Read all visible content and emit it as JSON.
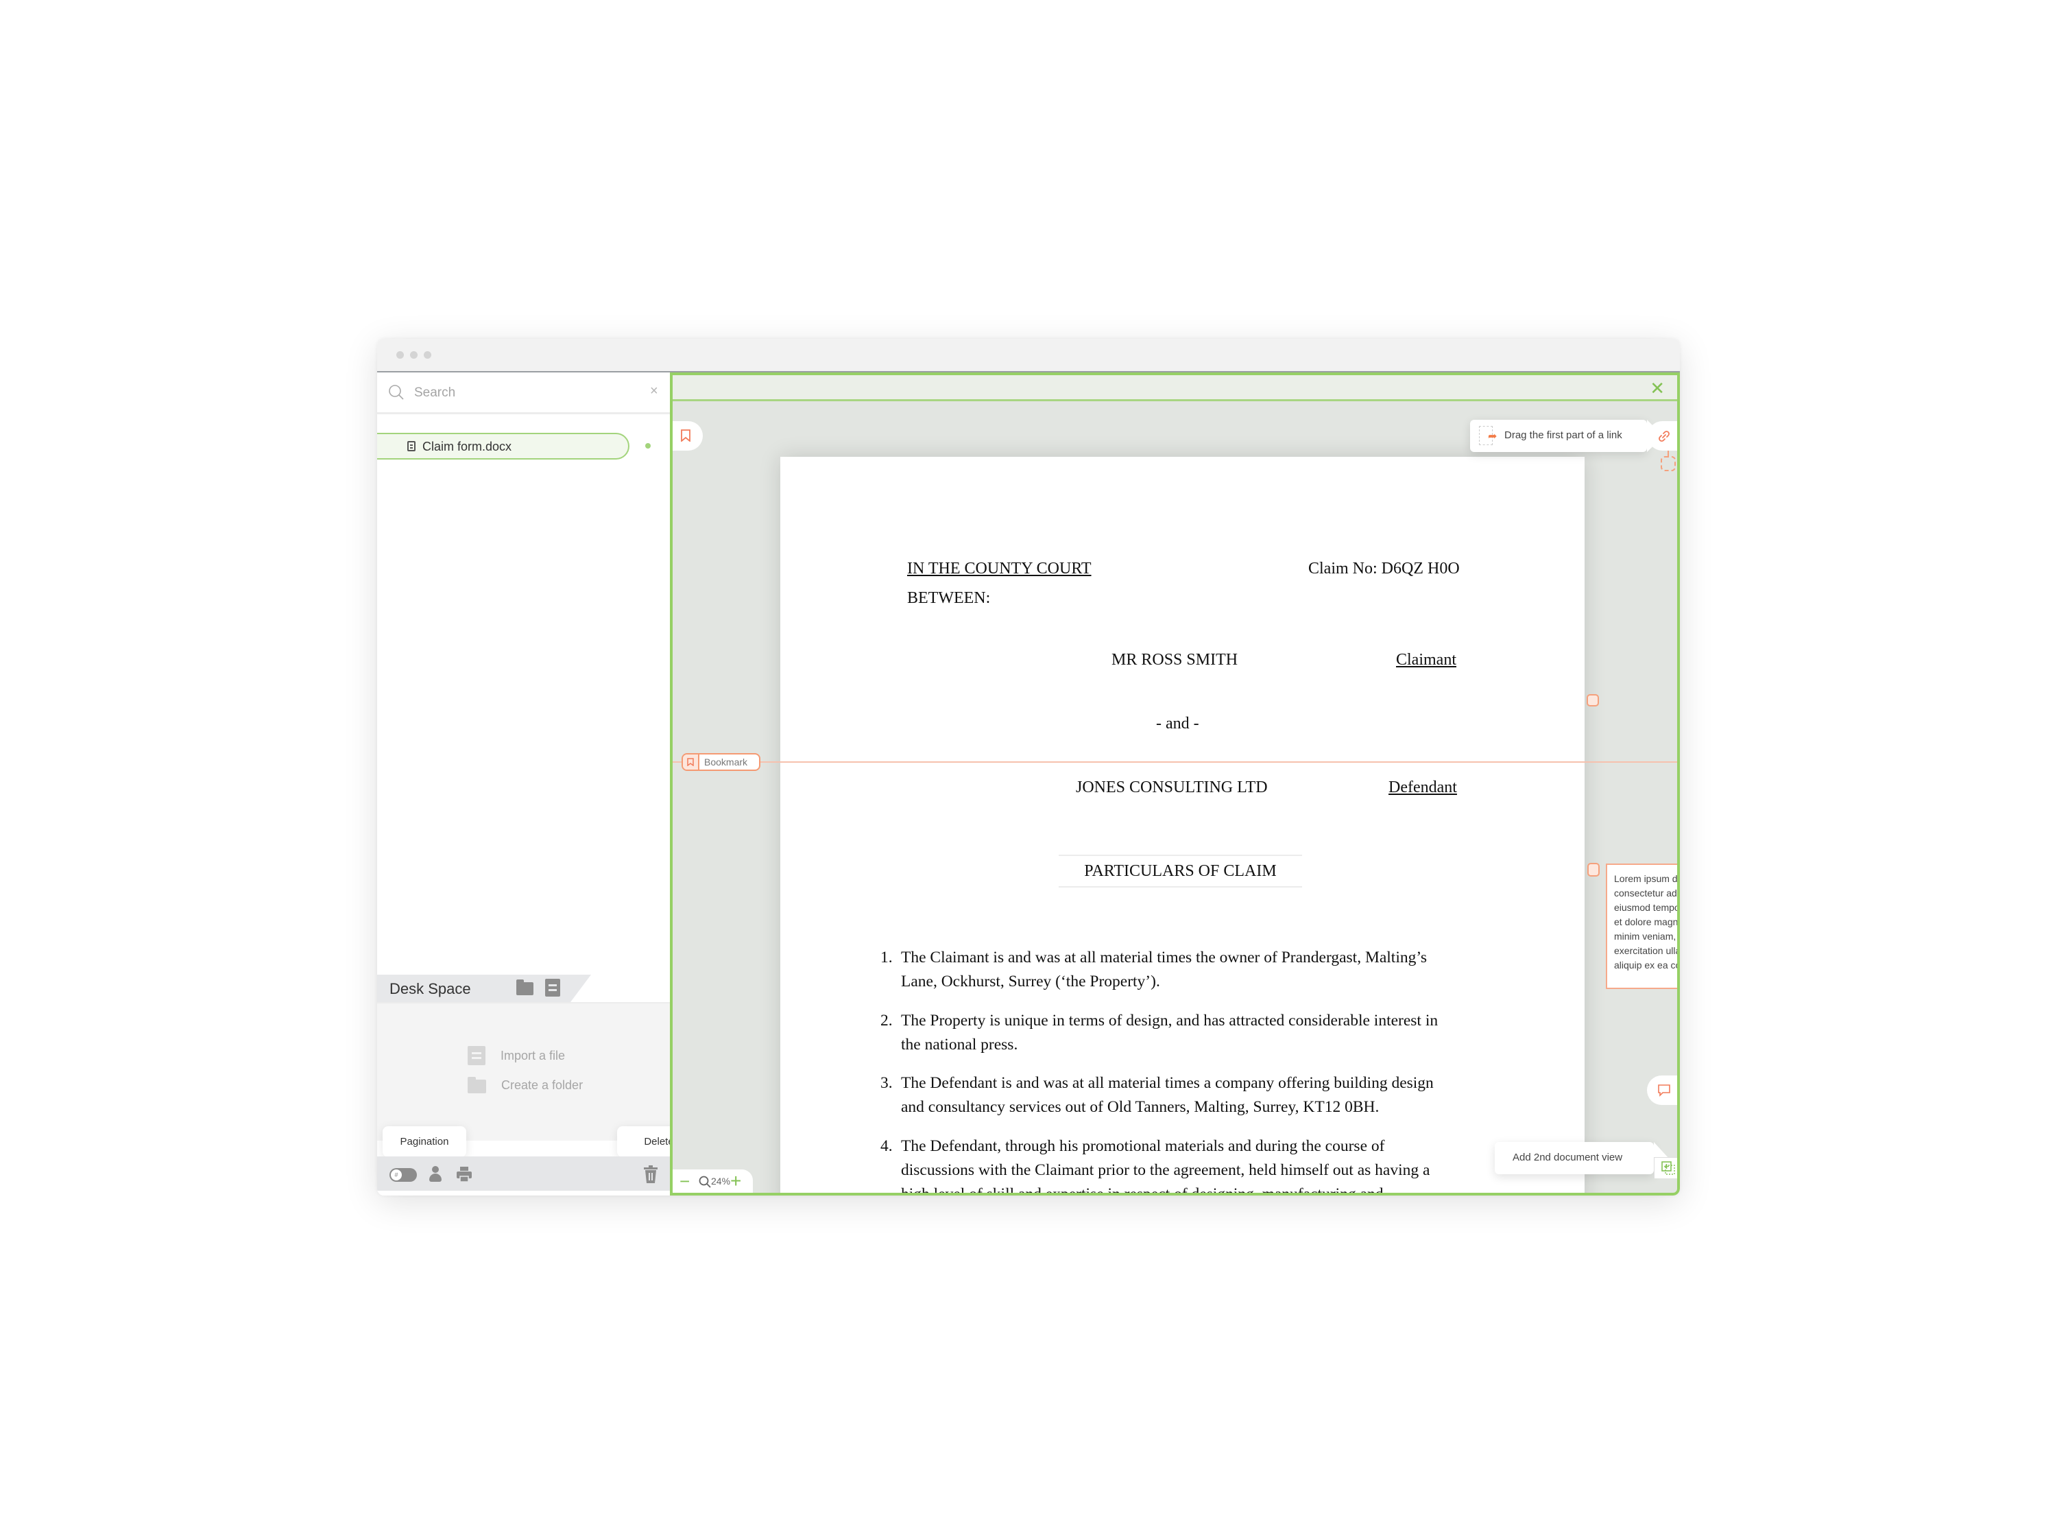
{
  "colors": {
    "accent_green": "#96d065",
    "annotation_orange": "#f5a07c",
    "viewer_background": "#e2e5e1"
  },
  "sidebar": {
    "search": {
      "placeholder": "Search",
      "value": ""
    },
    "files": [
      {
        "name": "Claim form.docx",
        "selected": true
      }
    ],
    "desk_space": {
      "title": "Desk Space",
      "actions": [
        {
          "label": "Import a file",
          "icon": "file-icon"
        },
        {
          "label": "Create a folder",
          "icon": "folder-icon"
        }
      ]
    },
    "tooltips": {
      "pagination": "Pagination",
      "delete": "Delete"
    },
    "pagination_toggle_glyph": "#"
  },
  "viewer": {
    "zoom_level": "24%",
    "link_tooltip": "Drag the first part of a link",
    "add_view_tooltip": "Add 2nd document view",
    "bookmark_label": "Bookmark",
    "comment_text": [
      "Lorem ipsum dolor sit amet,",
      "consectetur adipiscing elit, sed do",
      "eiusmod tempor incididunt ut labore",
      "et dolore magna aliqua. Ut enim ad",
      "minim veniam, quis nostrud",
      "exercitation ullamco laboris nisi ut",
      "aliquip ex ea commodo consequat."
    ]
  },
  "document": {
    "court": "IN THE COUNTY COURT",
    "claim_no": "Claim No: D6QZ H0O",
    "between": "BETWEEN:",
    "claimant_name": "MR ROSS SMITH",
    "claimant_role": "Claimant",
    "and": "- and -",
    "defendant_name": "JONES CONSULTING LTD",
    "defendant_role": "Defendant",
    "heading": "PARTICULARS OF CLAIM",
    "paragraphs": [
      {
        "num": "1.",
        "text": "The Claimant is and was at all material times the owner of Prandergast, Malting’s Lane, Ockhurst, Surrey (‘the Property’)."
      },
      {
        "num": "2.",
        "text": "The Property is unique in terms of design, and has attracted considerable interest in the national press."
      },
      {
        "num": "3.",
        "text": "The Defendant is and was at all material times a company offering building design and consultancy services out of Old Tanners, Malting, Surrey, KT12 0BH."
      },
      {
        "num": "4.",
        "text": "The Defendant, through his promotional materials and during the course of discussions with the Claimant prior to the agreement, held himself out as having a high level of skill and expertise in respect of designing, manufacturing and"
      }
    ]
  }
}
